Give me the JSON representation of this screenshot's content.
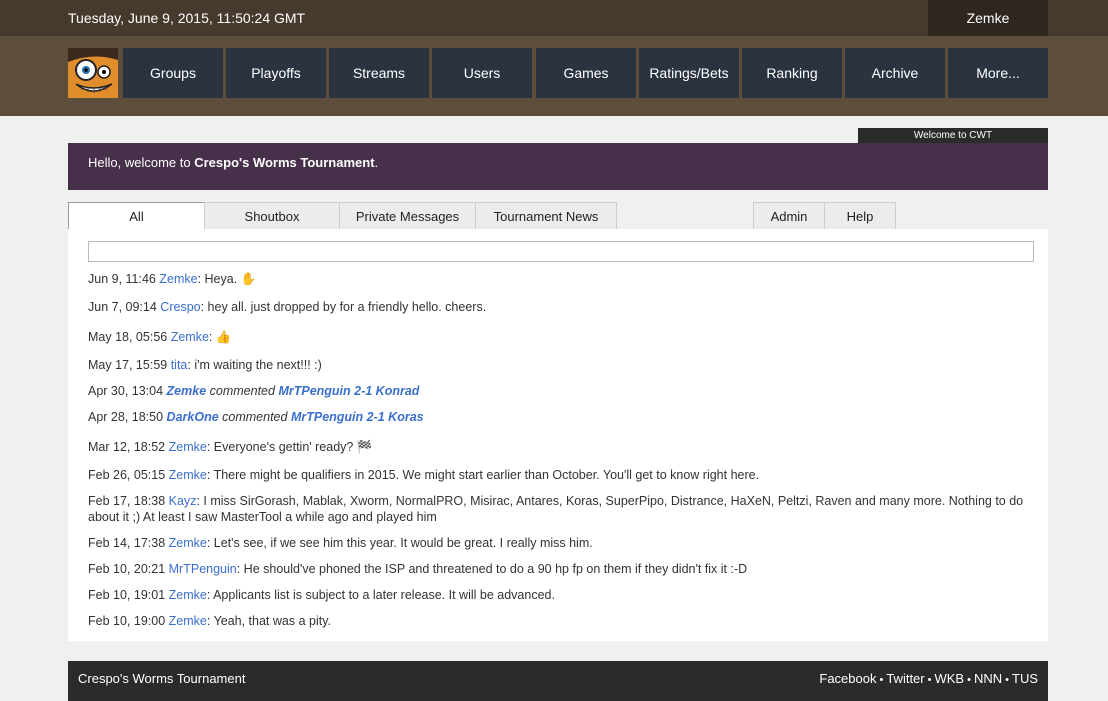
{
  "header": {
    "datetime": "Tuesday, June 9, 2015, 11:50:24 GMT",
    "username": "Zemke"
  },
  "nav": [
    {
      "label": "Groups"
    },
    {
      "label": "Playoffs"
    },
    {
      "label": "Streams"
    },
    {
      "label": "Users"
    },
    {
      "label": "Games"
    },
    {
      "label": "Ratings/Bets"
    },
    {
      "label": "Ranking"
    },
    {
      "label": "Archive"
    },
    {
      "label": "More..."
    }
  ],
  "welcome_tab": "Welcome to CWT",
  "banner": {
    "prefix": "Hello, welcome to ",
    "site": "Crespo's Worms Tournament",
    "suffix": "."
  },
  "tabs": {
    "all": "All",
    "shoutbox": "Shoutbox",
    "private": "Private Messages",
    "news": "Tournament News",
    "admin": "Admin",
    "help": "Help"
  },
  "messages": [
    {
      "time": "Jun 9, 11:46",
      "author": "Zemke",
      "text": ": Heya. ✋"
    },
    {
      "time": "Jun 7, 09:14",
      "author": "Crespo",
      "text": ": hey all. just dropped by for a friendly hello. cheers."
    },
    {
      "time": "May 18, 05:56",
      "author": "Zemke",
      "text": ": 👍"
    },
    {
      "time": "May 17, 15:59",
      "author": "tita",
      "text": ": i'm waiting the next!!! :)"
    },
    {
      "time": "Apr 30, 13:04",
      "author": "Zemke",
      "verb": "commented",
      "target": "MrTPenguin 2-1 Konrad"
    },
    {
      "time": "Apr 28, 18:50",
      "author": "DarkOne",
      "verb": "commented",
      "target": "MrTPenguin 2-1 Koras"
    },
    {
      "time": "Mar 12, 18:52",
      "author": "Zemke",
      "text": ": Everyone's gettin' ready? 🏁"
    },
    {
      "time": "Feb 26, 05:15",
      "author": "Zemke",
      "text": ": There might be qualifiers in 2015. We might start earlier than October. You'll get to know right here."
    },
    {
      "time": "Feb 17, 18:38",
      "author": "Kayz",
      "text": ": I miss SirGorash, Mablak, Xworm, NormalPRO, Misirac, Antares, Koras, SuperPipo, Distrance, HaXeN, Peltzi, Raven and many more. Nothing to do about it ;) At least I saw MasterTool a while ago and played him"
    },
    {
      "time": "Feb 14, 17:38",
      "author": "Zemke",
      "text": ": Let's see, if we see him this year. It would be great. I really miss him."
    },
    {
      "time": "Feb 10, 20:21",
      "author": "MrTPenguin",
      "text": ": He should've phoned the ISP and threatened to do a 90 hp fp on them if they didn't fix it :-D"
    },
    {
      "time": "Feb 10, 19:01",
      "author": "Zemke",
      "text": ": Applicants list is subject to a later release. It will be advanced."
    },
    {
      "time": "Feb 10, 19:00",
      "author": "Zemke",
      "text": ": Yeah, that was a pity."
    }
  ],
  "footer": {
    "title": "Crespo's Worms Tournament",
    "links": [
      "Facebook",
      "Twitter",
      "WKB",
      "NNN",
      "TUS"
    ],
    "separator": "•"
  }
}
